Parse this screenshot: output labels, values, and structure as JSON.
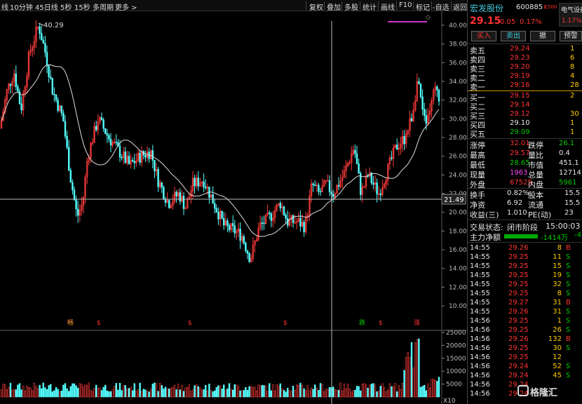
{
  "toolbar": {
    "periods": [
      "线",
      "10分钟",
      "45日线",
      "5秒",
      "15秒",
      "多周期",
      "更多 >"
    ],
    "tools": [
      "复权",
      "叠加",
      "多股",
      "统计",
      "画线",
      "F10",
      "标记",
      "-自选",
      "返回"
    ]
  },
  "chart": {
    "price_axis": [
      "40.00",
      "38.00",
      "36.00",
      "34.00",
      "32.00",
      "30.00",
      "28.00",
      "26.00",
      "24.00",
      "22.00",
      "20.00",
      "18.00",
      "16.00",
      "14.00",
      "12.00",
      "10.00"
    ],
    "crosshair_price": "21.49",
    "high_label": "40.29",
    "volume_axis": [
      "25000",
      "20000",
      "15000",
      "10000",
      "5000"
    ],
    "volume_unit": "X10",
    "markers": [
      {
        "text": "畅",
        "color": "#ff9933"
      },
      {
        "text": "$",
        "color": "#ff3333"
      },
      {
        "text": "$",
        "color": "#ff3333"
      },
      {
        "text": "$",
        "color": "#ff3333"
      },
      {
        "text": "跌",
        "color": "#00cc00"
      },
      {
        "text": "$",
        "color": "#ff3333"
      },
      {
        "text": "涨",
        "color": "#ff3333"
      }
    ]
  },
  "stock": {
    "name": "宏发股份",
    "code": "600885",
    "tag": "R",
    "tag2": "500",
    "sector": "电气设备",
    "sector_change": "1.17%",
    "price": "29.15",
    "change": "0.05",
    "change_pct": "0.17%"
  },
  "buttons": {
    "buy": "买入",
    "sell": "卖出",
    "cancel": "撤",
    "alert": "预警"
  },
  "asks": [
    {
      "label": "卖五",
      "price": "29.24",
      "vol": "1"
    },
    {
      "label": "卖四",
      "price": "29.23",
      "vol": "6"
    },
    {
      "label": "卖三",
      "price": "29.20",
      "vol": "8"
    },
    {
      "label": "卖二",
      "price": "29.19",
      "vol": "4"
    },
    {
      "label": "卖一",
      "price": "29.16",
      "vol": "28"
    }
  ],
  "bids": [
    {
      "label": "买一",
      "price": "29.15",
      "vol": "2"
    },
    {
      "label": "买二",
      "price": "29.14",
      "vol": ""
    },
    {
      "label": "买三",
      "price": "29.12",
      "vol": "30"
    },
    {
      "label": "买四",
      "price": "29.10",
      "vol": "1"
    },
    {
      "label": "买五",
      "price": "29.09",
      "vol": "1"
    }
  ],
  "stats": [
    {
      "l1": "涨停",
      "v1": "32.01",
      "l2": "跌停",
      "v2": "26.1"
    },
    {
      "l1": "最高",
      "v1": "29.57",
      "l2": "量比",
      "v2": "0.4"
    },
    {
      "l1": "最低",
      "v1": "28.65",
      "l2": "市值",
      "v2": "451.1"
    },
    {
      "l1": "现量",
      "v1": "1963",
      "l2": "总量",
      "v2": "12714"
    },
    {
      "l1": "外盘",
      "v1": "67525",
      "l2": "内盘",
      "v2": "5961"
    }
  ],
  "stats2": [
    {
      "l1": "换手",
      "v1": "0.82%",
      "l2": "股本",
      "v2": "15.5"
    },
    {
      "l1": "净资",
      "v1": "6.92",
      "l2": "流通",
      "v2": "15.5"
    },
    {
      "l1": "收益(三)",
      "v1": "1.010",
      "l2": "PE(动)",
      "v2": "23"
    }
  ],
  "status": {
    "label": "交易状态:",
    "value": "闭市阶段",
    "time": "15:00:03"
  },
  "netflow": {
    "label": "主力净额",
    "value": "-1414万",
    "extra": "-4"
  },
  "ticks": [
    {
      "t": "14:55",
      "p": "29.26",
      "v": "8",
      "s": "B"
    },
    {
      "t": "14:55",
      "p": "29.25",
      "v": "11",
      "s": "S"
    },
    {
      "t": "14:55",
      "p": "29.25",
      "v": "15",
      "s": "S"
    },
    {
      "t": "14:55",
      "p": "29.25",
      "v": "19",
      "s": "S"
    },
    {
      "t": "14:55",
      "p": "29.25",
      "v": "32",
      "s": "S"
    },
    {
      "t": "14:55",
      "p": "29.25",
      "v": "8",
      "s": "S"
    },
    {
      "t": "14:55",
      "p": "29.27",
      "v": "31",
      "s": "B"
    },
    {
      "t": "14:55",
      "p": "29.26",
      "v": "31",
      "s": "S"
    },
    {
      "t": "14:56",
      "p": "29.25",
      "v": "1",
      "s": "S"
    },
    {
      "t": "14:56",
      "p": "29.25",
      "v": "26",
      "s": "S"
    },
    {
      "t": "14:56",
      "p": "29.26",
      "v": "132",
      "s": "B"
    },
    {
      "t": "14:56",
      "p": "29.25",
      "v": "30",
      "s": "S"
    },
    {
      "t": "14:56",
      "p": "29.25",
      "v": "12",
      "s": ""
    },
    {
      "t": "14:56",
      "p": "29.24",
      "v": "52",
      "s": "S"
    },
    {
      "t": "14:56",
      "p": "29.24",
      "v": "45",
      "s": "S"
    },
    {
      "t": "14:56",
      "p": "29.24",
      "v": "",
      "s": ""
    },
    {
      "t": "14:56",
      "p": "29.24",
      "v": "",
      "s": ""
    }
  ],
  "watermark": "格隆汇"
}
